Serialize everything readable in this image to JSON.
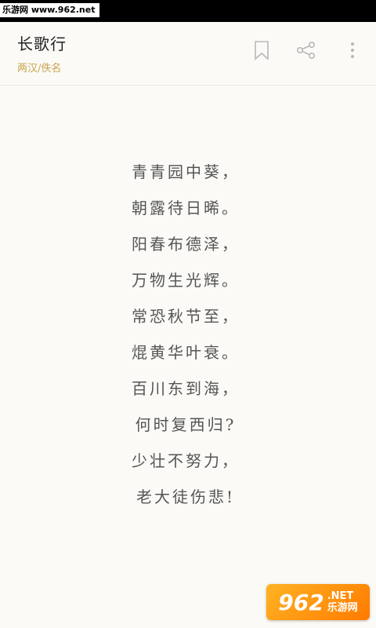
{
  "status_watermark": "乐游网 www.962.net",
  "header": {
    "title": "长歌行",
    "author": "两汉/佚名"
  },
  "icons": {
    "bookmark": "bookmark-icon",
    "share": "share-icon",
    "more": "more-vertical-icon"
  },
  "poem": {
    "lines": [
      "青青园中葵，",
      "朝露待日晞。",
      "阳春布德泽，",
      "万物生光辉。",
      "常恐秋节至，",
      "焜黄华叶衰。",
      "百川东到海，",
      "何时复西归?",
      "少壮不努力，",
      "老大徒伤悲!"
    ]
  },
  "watermark": {
    "number": "962",
    "net": ".NET",
    "site": "乐游网"
  },
  "colors": {
    "background": "#fbfaf6",
    "author": "#c9a24c",
    "poem_text": "#555555",
    "icon": "#bbbbbb"
  }
}
